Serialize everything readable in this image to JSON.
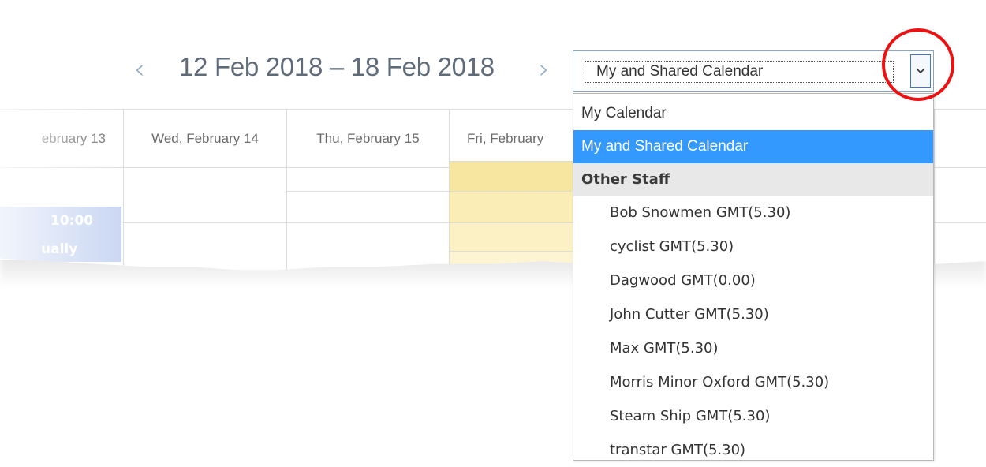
{
  "header": {
    "prev_glyph": "‹",
    "next_glyph": "›",
    "date_range": "12 Feb 2018 – 18 Feb 2018"
  },
  "calendar_select": {
    "value": "My and Shared Calendar"
  },
  "columns": [
    "ebruary 13",
    "Wed, February 14",
    "Thu, February 15",
    "Fri, February",
    "",
    ""
  ],
  "event": {
    "time": "10:00",
    "text": "ually"
  },
  "dropdown": {
    "top_items": [
      "My Calendar",
      "My and Shared Calendar"
    ],
    "selected_index": 1,
    "group_label": "Other Staff",
    "staff": [
      "Bob Snowmen GMT(5.30)",
      "cyclist GMT(5.30)",
      "Dagwood GMT(0.00)",
      "John Cutter GMT(5.30)",
      "Max GMT(5.30)",
      "Morris Minor Oxford GMT(5.30)",
      "Steam Ship GMT(5.30)",
      "transtar GMT(5.30)"
    ]
  },
  "colors": {
    "selected_bg": "#3399ff",
    "annotation_circle": "#ee1111",
    "highlight_column": "#fbeeb0"
  },
  "icons": {
    "select_arrow": "chevron-down-icon"
  }
}
